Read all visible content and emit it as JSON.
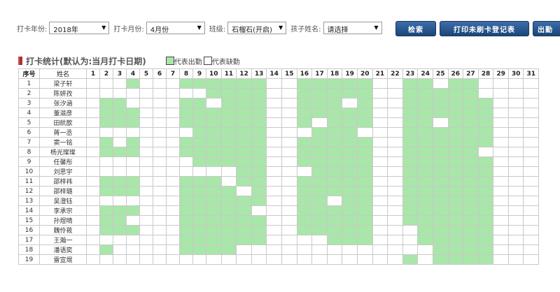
{
  "filters": {
    "year_label": "打卡年份:",
    "year_value": "2018年",
    "month_label": "打卡月份:",
    "month_value": "4月份",
    "class_label": "班级:",
    "class_value": "石榴石(开启)",
    "child_label": "孩子姓名:",
    "child_value": "请选择"
  },
  "buttons": {
    "search": "检索",
    "print": "打印未刷卡登记表",
    "export": "出勤"
  },
  "section": {
    "title": "打卡统计(默认为:当月打卡日期)",
    "legend_present": "代表出勤",
    "legend_absent": "代表缺勤"
  },
  "colors": {
    "present": "#a9e6a9",
    "absent": "#ffffff",
    "button": "#1f4e8a"
  },
  "table": {
    "col_index": "序号",
    "col_name": "姓名",
    "days": [
      "1",
      "2",
      "3",
      "4",
      "5",
      "6",
      "7",
      "8",
      "9",
      "10",
      "11",
      "12",
      "13",
      "14",
      "15",
      "16",
      "17",
      "18",
      "19",
      "20",
      "21",
      "22",
      "23",
      "24",
      "25",
      "26",
      "27",
      "28",
      "29",
      "30",
      "31"
    ],
    "rows": [
      {
        "no": "1",
        "name": "梁子轩",
        "present": [
          4,
          8,
          9,
          10,
          11,
          12,
          13,
          16,
          17,
          18,
          19,
          20,
          23,
          24,
          26,
          27
        ]
      },
      {
        "no": "2",
        "name": "陈妍孜",
        "present": [
          10,
          11,
          12,
          13,
          16,
          17,
          18,
          19,
          20,
          23,
          24,
          25,
          26,
          27
        ]
      },
      {
        "no": "3",
        "name": "张汐涵",
        "present": [
          2,
          3,
          8,
          9,
          11,
          12,
          13,
          16,
          17,
          18,
          20,
          23,
          24,
          25,
          26,
          27,
          28
        ]
      },
      {
        "no": "4",
        "name": "董滋彦",
        "present": [
          2,
          3,
          4,
          8,
          9,
          10,
          11,
          12,
          13,
          16,
          17,
          18,
          19,
          20,
          23,
          24,
          25,
          26,
          27,
          28
        ]
      },
      {
        "no": "5",
        "name": "田航歆",
        "present": [
          2,
          3,
          4,
          8,
          9,
          10,
          11,
          12,
          13,
          16,
          18,
          19,
          20,
          23,
          24,
          26,
          27,
          28
        ]
      },
      {
        "no": "6",
        "name": "蒋一丞",
        "present": [
          9,
          10,
          11,
          12,
          13,
          17,
          18,
          19,
          23,
          24,
          25,
          26,
          27,
          28
        ]
      },
      {
        "no": "7",
        "name": "窦一铭",
        "present": [
          2,
          4,
          8,
          9,
          10,
          11,
          12,
          13,
          16,
          17,
          18,
          19,
          20,
          23,
          24,
          25,
          26,
          27,
          28
        ]
      },
      {
        "no": "8",
        "name": "杨光璨璨",
        "present": [
          2,
          3,
          4,
          8,
          9,
          10,
          11,
          12,
          13,
          16,
          17,
          18,
          19,
          20,
          23,
          24,
          25,
          26,
          27
        ]
      },
      {
        "no": "9",
        "name": "任馨彤",
        "present": [
          9,
          10,
          11,
          12,
          13,
          16,
          17,
          18,
          19,
          20,
          23,
          24,
          25,
          26,
          27,
          28
        ]
      },
      {
        "no": "10",
        "name": "刘思宇",
        "present": [
          12,
          13,
          17,
          18,
          19,
          20,
          23,
          24,
          25,
          26,
          27,
          28
        ]
      },
      {
        "no": "11",
        "name": "邵梓祎",
        "present": [
          2,
          3,
          4,
          8,
          9,
          10,
          12,
          13,
          16,
          17,
          18,
          19,
          20,
          23,
          24,
          25,
          26,
          27,
          28
        ]
      },
      {
        "no": "12",
        "name": "邵梓璐",
        "present": [
          2,
          3,
          4,
          8,
          9,
          10,
          11,
          13,
          16,
          17,
          18,
          19,
          20,
          23,
          24,
          25,
          26,
          27,
          28
        ]
      },
      {
        "no": "13",
        "name": "吴澄钰",
        "present": [
          8,
          9,
          10,
          11,
          12,
          13,
          16,
          17,
          19,
          20,
          23,
          24,
          25,
          26,
          27,
          28
        ]
      },
      {
        "no": "14",
        "name": "李承宗",
        "present": [
          2,
          3,
          4,
          8,
          9,
          10,
          11,
          12,
          16,
          17,
          18,
          19,
          20,
          23,
          24,
          25,
          26,
          27,
          28
        ]
      },
      {
        "no": "15",
        "name": "孙煜晴",
        "present": [
          2,
          3,
          8,
          9,
          10,
          11,
          12,
          13,
          16,
          17,
          18,
          19,
          20,
          23,
          24,
          25,
          26,
          27,
          28
        ]
      },
      {
        "no": "16",
        "name": "魏伶莜",
        "present": [
          2,
          3,
          4,
          8,
          9,
          10,
          11,
          12,
          13,
          16,
          17,
          18,
          19,
          20,
          24,
          25,
          26,
          27,
          28
        ]
      },
      {
        "no": "17",
        "name": "王瀚一",
        "present": [
          8,
          9,
          10,
          11,
          12,
          13,
          18,
          19,
          20,
          24,
          25,
          26,
          27,
          28
        ]
      },
      {
        "no": "18",
        "name": "潘语奕",
        "present": [
          2,
          8,
          9,
          10,
          11,
          25,
          26,
          27,
          28
        ]
      },
      {
        "no": "19",
        "name": "雷宣焜",
        "present": [
          23,
          25,
          26,
          27,
          28
        ]
      }
    ]
  }
}
